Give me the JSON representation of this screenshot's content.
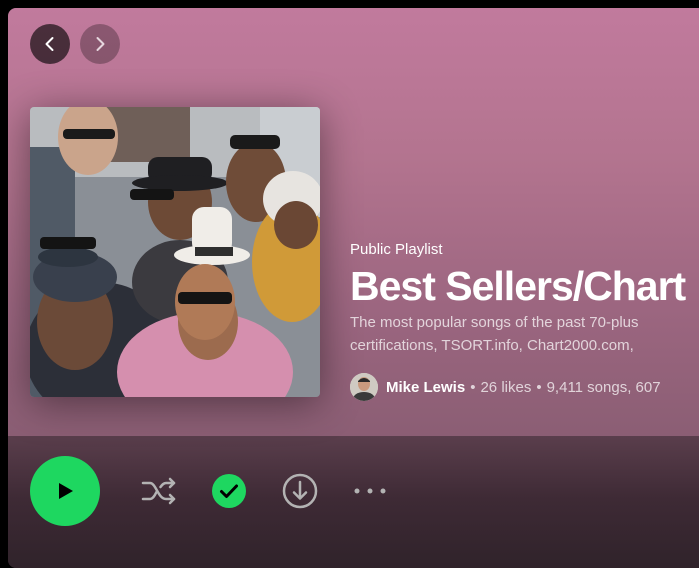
{
  "nav": {
    "back_icon": "chevron-left-icon",
    "forward_icon": "chevron-right-icon"
  },
  "playlist": {
    "type_label": "Public Playlist",
    "title": "Best Sellers/Chart",
    "description_line1": "The most popular songs of the past 70-plus",
    "description_line2": "certifications, TSORT.info, Chart2000.com,",
    "owner": "Mike Lewis",
    "separator": "•",
    "likes": "26 likes",
    "songs_duration": "9,411 songs, 607"
  },
  "actions": {
    "play_icon": "play-icon",
    "shuffle_icon": "shuffle-icon",
    "saved_icon": "check-circle-icon",
    "download_icon": "download-icon",
    "more_icon": "more-dots-icon"
  },
  "colors": {
    "accent": "#1ed760",
    "hero_top": "#c17a9d",
    "hero_bottom": "#8b5e74"
  }
}
